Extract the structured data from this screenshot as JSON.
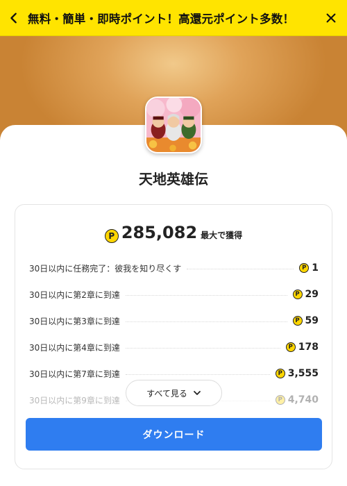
{
  "header": {
    "title": "無料・簡単・即時ポイント！高還元ポイント多数！",
    "back_icon": "chevron-left-icon",
    "close_icon": "close-icon",
    "background_color": "#ffe400"
  },
  "app": {
    "name": "天地英雄伝"
  },
  "reward": {
    "coin_symbol": "P",
    "total": "285,082",
    "total_label": "最大で獲得"
  },
  "tasks": [
    {
      "label": "30日以内に任務完了：彼我を知り尽くす",
      "value": "1"
    },
    {
      "label": "30日以内に第2章に到達",
      "value": "29"
    },
    {
      "label": "30日以内に第3章に到達",
      "value": "59"
    },
    {
      "label": "30日以内に第4章に到達",
      "value": "178"
    },
    {
      "label": "30日以内に第7章に到達",
      "value": "3,555"
    },
    {
      "label": "30日以内に第9章に到達",
      "value": "4,740"
    }
  ],
  "buttons": {
    "show_all": "すべて見る",
    "download": "ダウンロード"
  },
  "colors": {
    "accent": "#2f7df0",
    "coin": "#ffd600"
  }
}
